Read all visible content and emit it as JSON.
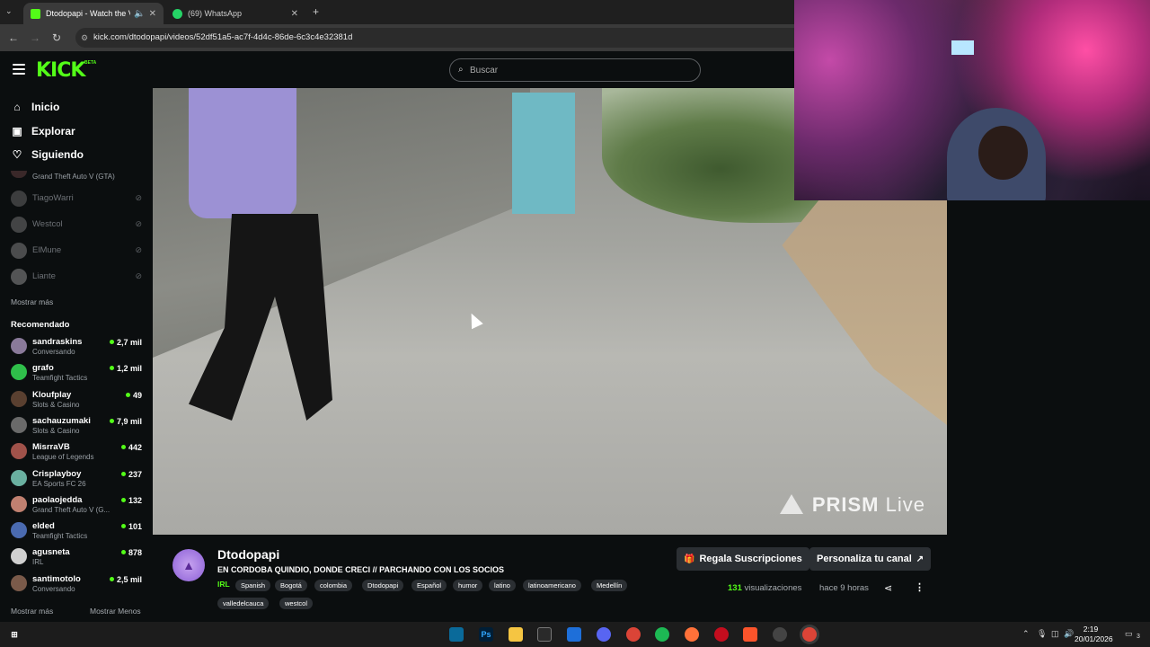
{
  "browser": {
    "tabs": [
      {
        "label": "Dtodopapi - Watch the VOD",
        "icon": "kick-favicon",
        "active": true
      },
      {
        "label": "(69) WhatsApp",
        "icon": "whatsapp-favicon",
        "active": false
      }
    ],
    "url": "kick.com/dtodopapi/videos/52df51a5-ac7f-4d4c-86de-6c3c4e32381d"
  },
  "header": {
    "logo": "KICK",
    "logo_badge": "BETA",
    "search_placeholder": "Buscar"
  },
  "sidebar": {
    "nav": [
      {
        "label": "Inicio",
        "icon": "home-icon"
      },
      {
        "label": "Explorar",
        "icon": "compass-icon"
      },
      {
        "label": "Siguiendo",
        "icon": "heart-icon"
      }
    ],
    "following_partial_category": "Grand Theft Auto V (GTA)",
    "following": [
      {
        "name": "TiagoWarri"
      },
      {
        "name": "Westcol"
      },
      {
        "name": "ElMune"
      },
      {
        "name": "Liante"
      }
    ],
    "show_more": "Mostrar más",
    "recommended_title": "Recomendado",
    "recommended": [
      {
        "name": "sandraskins",
        "category": "Conversando",
        "viewers": "2,7 mil",
        "color": "#8a7a9a"
      },
      {
        "name": "grafo",
        "category": "Teamfight Tactics",
        "viewers": "1,2 mil",
        "color": "#2fbf4a"
      },
      {
        "name": "Kloufplay",
        "category": "Slots & Casino",
        "viewers": "49",
        "color": "#5a4030"
      },
      {
        "name": "sachauzumaki",
        "category": "Slots & Casino",
        "viewers": "7,9 mil",
        "color": "#6a6a6a"
      },
      {
        "name": "MisrraVB",
        "category": "League of Legends",
        "viewers": "442",
        "color": "#a0524a"
      },
      {
        "name": "Crisplayboy",
        "category": "EA Sports FC 26",
        "viewers": "237",
        "color": "#6ab0a0"
      },
      {
        "name": "paolaojedda",
        "category": "Grand Theft Auto V (G...",
        "viewers": "132",
        "color": "#c08070"
      },
      {
        "name": "elded",
        "category": "Teamfight Tactics",
        "viewers": "101",
        "color": "#4a6ab0"
      },
      {
        "name": "agusneta",
        "category": "IRL",
        "viewers": "878",
        "color": "#d0d0d0"
      },
      {
        "name": "santimotolo",
        "category": "Conversando",
        "viewers": "2,5 mil",
        "color": "#7a5a4a"
      }
    ],
    "show_more_bottom": "Mostrar más",
    "show_less": "Mostrar Menos"
  },
  "video": {
    "watermark_prefix": "PRISM",
    "watermark_suffix": "Live"
  },
  "info": {
    "streamer": "Dtodopapi",
    "title": "EN CORDOBA QUINDIO, DONDE CRECI // PARCHANDO CON LOS SOCIOS",
    "category": "IRL",
    "tags": [
      "Spanish",
      "Bogotá",
      "colombia",
      "Dtodopapi",
      "Español",
      "humor",
      "latino",
      "latinoamericano",
      "Medellín",
      "valledelcauca",
      "westcol"
    ],
    "gift_button": "Regala Suscripciones",
    "customize_button": "Personaliza tu canal",
    "views_count": "131",
    "views_label": "visualizaciones",
    "ago": "hace 9 horas"
  },
  "taskbar": {
    "time": "2:19",
    "date": "20/01/2026",
    "notifications": "3"
  }
}
